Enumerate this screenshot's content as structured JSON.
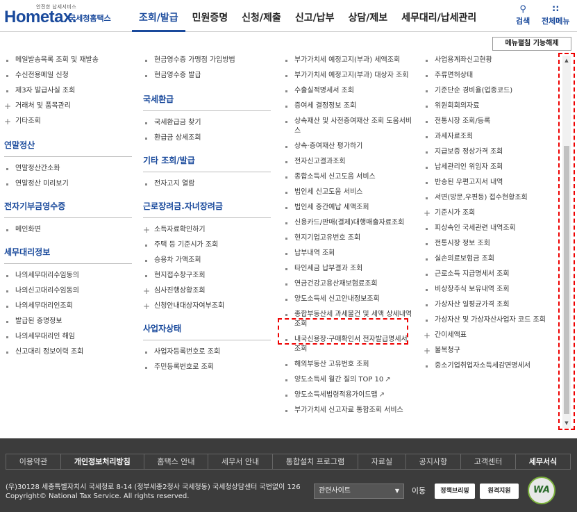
{
  "header": {
    "logo_tag": "안전한 납세서비스",
    "logo_main": "Hometax.",
    "logo_sub": "국세청홈택스",
    "nav": [
      "조회/발급",
      "민원증명",
      "신청/제출",
      "신고/납부",
      "상담/제보",
      "세무대리/납세관리"
    ],
    "search_label": "검색",
    "allmenu_label": "전체메뉴"
  },
  "close_menu_label": "메뉴펼침 기능해제",
  "col1": {
    "items_a": [
      "메일발송목록 조회 및 재발송",
      "수신전용메일 신청",
      "제3자 발급사실 조회"
    ],
    "items_a_plus": [
      "거래처 및 품목관리",
      "기타조회"
    ],
    "sec_yearend": "연말정산",
    "items_yearend": [
      "연말정산간소화",
      "연말정산 미리보기"
    ],
    "sec_ereceipt": "전자기부금영수증",
    "items_ereceipt": [
      "메인화면"
    ],
    "sec_agent": "세무대리정보",
    "items_agent": [
      "나의세무대리수임동의",
      "나의신고대리수임동의",
      "나의세무대리인조회",
      "발급된 증명정보",
      "나의세무대리인 해임",
      "신고대리 정보이력 조회"
    ]
  },
  "col2": {
    "items_a": [
      "현금영수증 가맹점 가입방법",
      "현금영수증 발급"
    ],
    "sec_refund": "국세환급",
    "items_refund": [
      "국세환급금 찾기",
      "환급금 상세조회"
    ],
    "sec_etc": "기타 조회/발급",
    "items_etc": [
      "전자고지 열람"
    ],
    "sec_eitc": "근로장려금.자녀장려금",
    "items_eitc_plus": [
      "소득자료확인하기"
    ],
    "items_eitc": [
      "주택 등 기준시가 조회",
      "승용차 가액조회",
      "현지접수창구조회"
    ],
    "items_eitc_plus2": [
      "심사진행상황조회",
      "신청안내대상자여부조회"
    ],
    "sec_biz": "사업자상태",
    "items_biz": [
      "사업자등록번호로 조회",
      "주민등록번호로 조회"
    ]
  },
  "col3": {
    "items": [
      "부가가치세 예정고지(부과) 세액조회",
      "부가가치세 예정고지(부과) 대상자 조회",
      "수출실적명세서 조회",
      "증여세 결정정보 조회",
      "상속재산 및 사전증여재산 조회 도움서비스",
      "상속·증여재산 평가하기",
      "전자신고결과조회",
      "종합소득세 신고도움 서비스",
      "법인세 신고도움 서비스",
      "법인세 중간예납 세액조회",
      "신용카드/판매(결제)대행매출자료조회",
      "현지기업고유번호 조회",
      "납부내역 조회",
      "타인세금 납부결과 조회",
      "연금건강고용산재보험료조회",
      "양도소득세 신고안내정보조회",
      "종합부동산세 과세물건 및 세액 상세내역 조회",
      "내국신용장·구매확인서 전자발급명세서 조회",
      "해외부동산 고유번호 조회"
    ],
    "items_ext": [
      "양도소득세 월간 질의 TOP 10",
      "양도소득세법령적용가이드맵"
    ],
    "items_last": [
      "부가가치세 신고자료 통합조회 서비스"
    ]
  },
  "col4": {
    "items": [
      "사업용계좌신고현황",
      "주류면허상태",
      "기준단순 경비율(업종코드)",
      "위원회회의자료",
      "전통시장 조회/등록",
      "과세자료조회",
      "지급보증 정상가격 조회",
      "납세관리인 위임자 조회",
      "반송된 우편고지서 내역",
      "서면(방문,우편등) 접수현황조회"
    ],
    "items_plus1": [
      "기준시가 조회"
    ],
    "items_b": [
      "피상속인 국세관련 내역조회",
      "전통시장 정보 조회",
      "실손의료보험금 조회",
      "근로소득 지급명세서 조회",
      "비상장주식 보유내역 조회",
      "가상자산 일평균가격 조회",
      "가상자산 및 가상자산사업자 코드 조회"
    ],
    "items_plus2": [
      "간이세액표",
      "불복청구"
    ],
    "items_c": [
      "중소기업취업자소득세감면명세서"
    ]
  },
  "footer": {
    "nav": [
      "이용약관",
      "개인정보처리방침",
      "홈택스 안내",
      "세무서 안내",
      "통합설치 프로그램",
      "자료실",
      "공지사항",
      "고객센터",
      "세무서식"
    ],
    "address": "(우)30128 세종특별자치시 국세청로 8-14 (정부세종2청사 국세청동) 국세청상담센터 국번없이 126",
    "copyright": "Copyright© National Tax Service. All rights reserved.",
    "related_select": "관련사이트",
    "go_label": "이동",
    "btn_policy": "정책브리핑",
    "btn_remote": "원격지원",
    "wa_mark": "WA"
  },
  "colors": {
    "brand_blue": "#1a4a9c",
    "highlight_red": "#e00000",
    "footer_bg": "#3c3c3c"
  }
}
